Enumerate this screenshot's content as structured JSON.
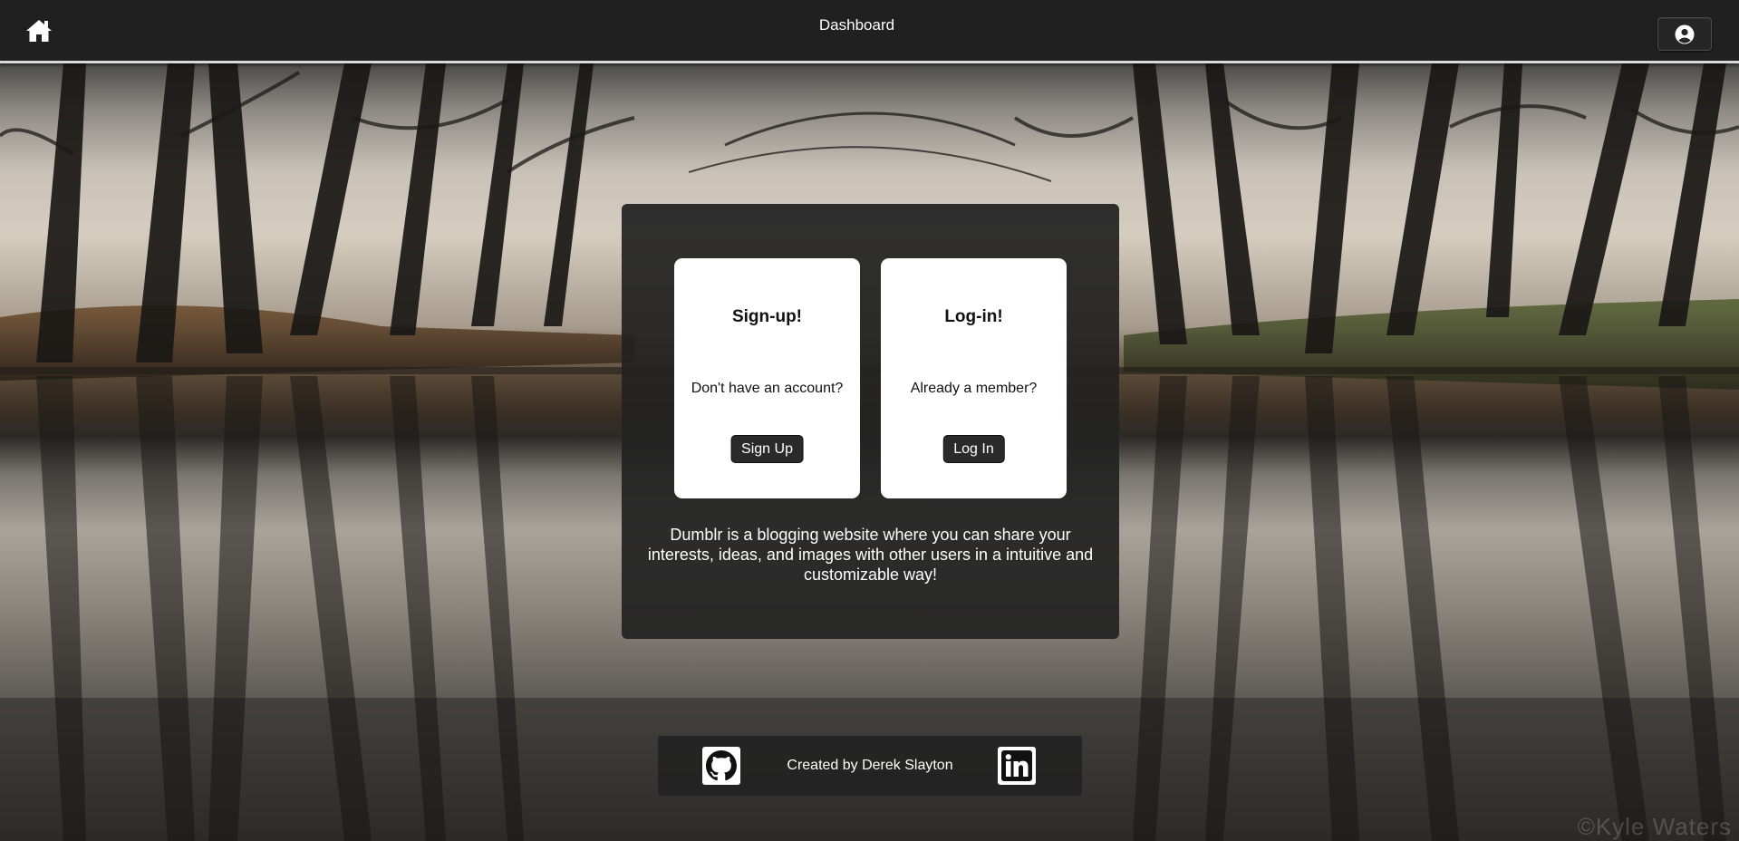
{
  "header": {
    "title": "Dashboard",
    "home_icon": "home-icon",
    "account_icon": "user-circle-icon"
  },
  "signup_card": {
    "title": "Sign-up!",
    "text": "Don't have an account?",
    "button_label": "Sign Up"
  },
  "login_card": {
    "title": "Log-in!",
    "text": "Already a member?",
    "button_label": "Log In"
  },
  "description": "Dumblr is a blogging website where you can share your interests, ideas, and images with other users in a intuitive and customizable way!",
  "footer": {
    "credit": "Created by Derek Slayton",
    "github_icon": "github-icon",
    "linkedin_icon": "linkedin-icon"
  },
  "watermark": "©Kyle Waters",
  "colors": {
    "header_bg": "#202020",
    "panel_bg": "#222222",
    "button_bg": "#2a2a2a",
    "card_bg": "#ffffff"
  }
}
